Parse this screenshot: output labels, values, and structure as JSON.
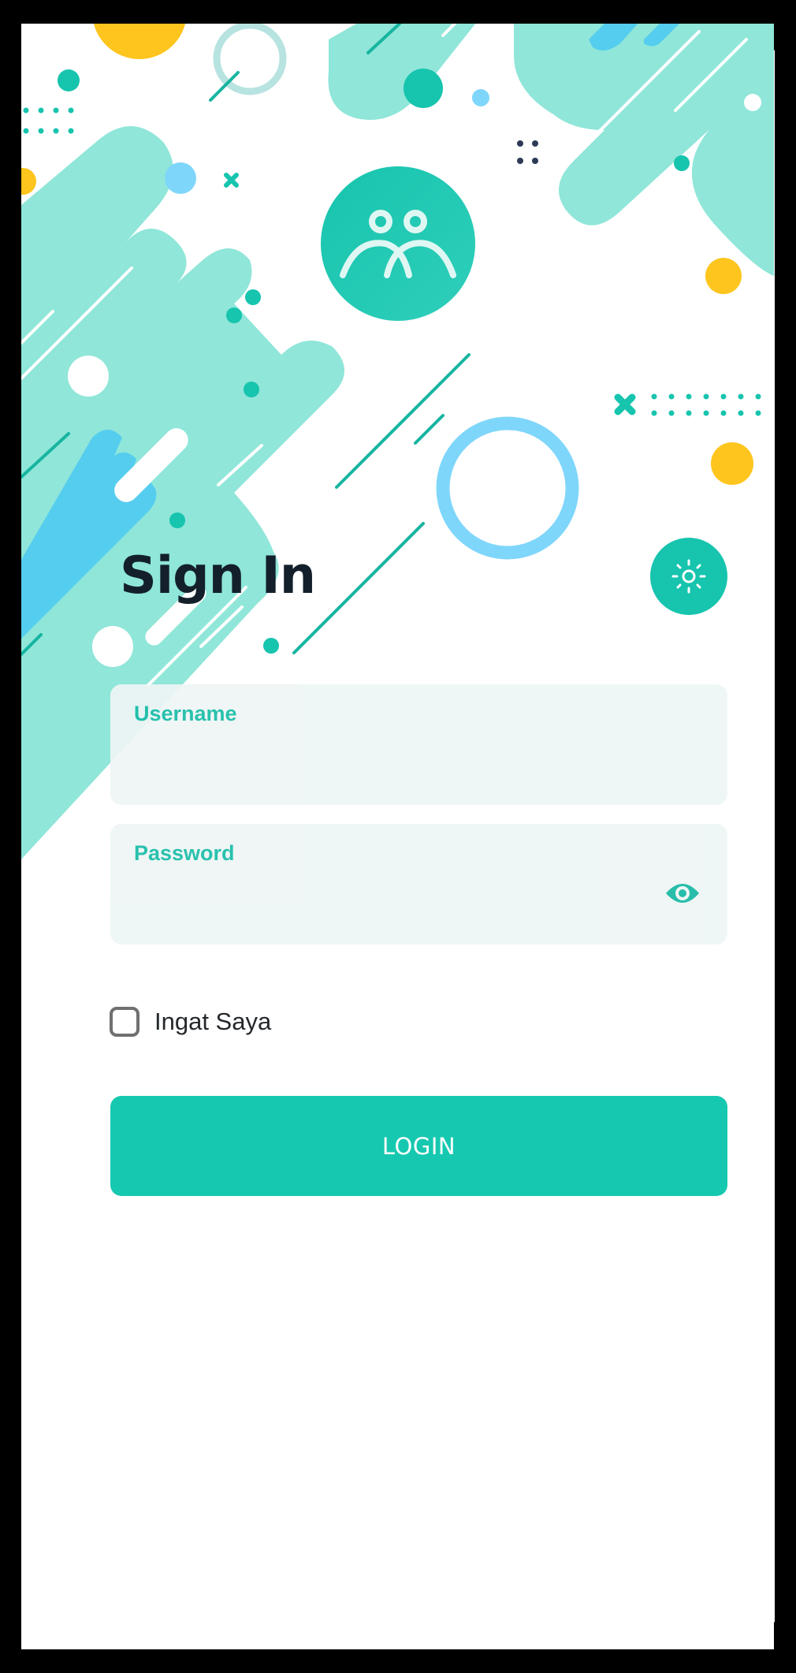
{
  "auth": {
    "title": "Sign In",
    "username_label": "Username",
    "username_value": "",
    "password_label": "Password",
    "password_value": "",
    "remember_label": "Ingat Saya",
    "login_label": "LOGIN"
  },
  "icons": {
    "logo": "people-group-icon",
    "theme_toggle": "sun-icon",
    "password_visibility": "eye-icon",
    "remember_checkbox": "checkbox-unchecked"
  },
  "colors": {
    "accent": "#17c8b0",
    "accent_light": "#8fe6d9",
    "sky": "#7fd6fb",
    "yellow": "#fdc51d",
    "title": "#13202b",
    "field_bg": "#eef6f5"
  }
}
